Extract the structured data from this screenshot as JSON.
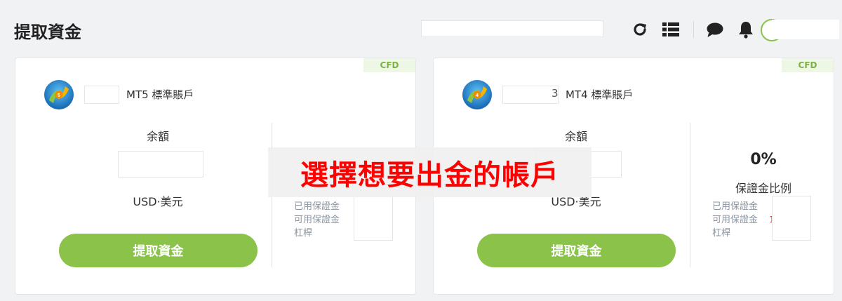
{
  "header": {
    "title": "提取資金",
    "icons": [
      "refresh-icon",
      "list-icon",
      "chat-icon",
      "bell-icon"
    ]
  },
  "accounts": [
    {
      "platform": "MT5",
      "type_label": "MT5 標準賬戶",
      "tag": "CFD",
      "balance_label": "余額",
      "currency": "USD·美元",
      "withdraw_label": "提取資金"
    },
    {
      "platform": "MT4",
      "type_label": "MT4 標準賬戶",
      "account_suffix": "3",
      "tag": "CFD",
      "balance_label": "余額",
      "currency": "USD·美元",
      "withdraw_label": "提取資金",
      "margin_ratio": "0%",
      "margin_ratio_label": "保證金比例",
      "stats": [
        "已用保證金",
        "可用保證金",
        "杠桿"
      ],
      "stat_value": "1"
    }
  ],
  "left_stats": [
    "已用保證金",
    "可用保證金",
    "杠桿"
  ],
  "annotation": "選擇想要出金的帳戶",
  "colors": {
    "accent": "#8bc34a",
    "annotation": "#ff0000",
    "tag_bg": "#eef6e6"
  }
}
